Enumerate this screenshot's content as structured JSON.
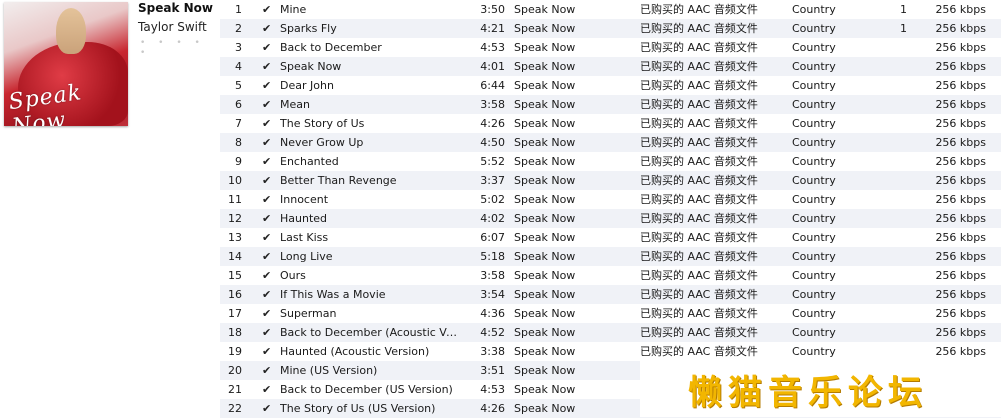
{
  "album": {
    "title": "Speak Now",
    "artist": "Taylor Swift",
    "rating": "• • • • •",
    "cover_text": "Speak Now"
  },
  "watermark": "懒猫音乐论坛",
  "tracks": [
    {
      "num": "1",
      "check": "✔",
      "name": "Mine",
      "time": "3:50",
      "album": "Speak Now",
      "kind": "已购买的 AAC 音频文件",
      "genre": "Country",
      "plays": "1",
      "bitrate": "256 kbps"
    },
    {
      "num": "2",
      "check": "✔",
      "name": "Sparks Fly",
      "time": "4:21",
      "album": "Speak Now",
      "kind": "已购买的 AAC 音频文件",
      "genre": "Country",
      "plays": "1",
      "bitrate": "256 kbps"
    },
    {
      "num": "3",
      "check": "✔",
      "name": "Back to December",
      "time": "4:53",
      "album": "Speak Now",
      "kind": "已购买的 AAC 音频文件",
      "genre": "Country",
      "plays": "",
      "bitrate": "256 kbps"
    },
    {
      "num": "4",
      "check": "✔",
      "name": "Speak Now",
      "time": "4:01",
      "album": "Speak Now",
      "kind": "已购买的 AAC 音频文件",
      "genre": "Country",
      "plays": "",
      "bitrate": "256 kbps"
    },
    {
      "num": "5",
      "check": "✔",
      "name": "Dear John",
      "time": "6:44",
      "album": "Speak Now",
      "kind": "已购买的 AAC 音频文件",
      "genre": "Country",
      "plays": "",
      "bitrate": "256 kbps"
    },
    {
      "num": "6",
      "check": "✔",
      "name": "Mean",
      "time": "3:58",
      "album": "Speak Now",
      "kind": "已购买的 AAC 音频文件",
      "genre": "Country",
      "plays": "",
      "bitrate": "256 kbps"
    },
    {
      "num": "7",
      "check": "✔",
      "name": "The Story of Us",
      "time": "4:26",
      "album": "Speak Now",
      "kind": "已购买的 AAC 音频文件",
      "genre": "Country",
      "plays": "",
      "bitrate": "256 kbps"
    },
    {
      "num": "8",
      "check": "✔",
      "name": "Never Grow Up",
      "time": "4:50",
      "album": "Speak Now",
      "kind": "已购买的 AAC 音频文件",
      "genre": "Country",
      "plays": "",
      "bitrate": "256 kbps"
    },
    {
      "num": "9",
      "check": "✔",
      "name": "Enchanted",
      "time": "5:52",
      "album": "Speak Now",
      "kind": "已购买的 AAC 音频文件",
      "genre": "Country",
      "plays": "",
      "bitrate": "256 kbps"
    },
    {
      "num": "10",
      "check": "✔",
      "name": "Better Than Revenge",
      "time": "3:37",
      "album": "Speak Now",
      "kind": "已购买的 AAC 音频文件",
      "genre": "Country",
      "plays": "",
      "bitrate": "256 kbps"
    },
    {
      "num": "11",
      "check": "✔",
      "name": "Innocent",
      "time": "5:02",
      "album": "Speak Now",
      "kind": "已购买的 AAC 音频文件",
      "genre": "Country",
      "plays": "",
      "bitrate": "256 kbps"
    },
    {
      "num": "12",
      "check": "✔",
      "name": "Haunted",
      "time": "4:02",
      "album": "Speak Now",
      "kind": "已购买的 AAC 音频文件",
      "genre": "Country",
      "plays": "",
      "bitrate": "256 kbps"
    },
    {
      "num": "13",
      "check": "✔",
      "name": "Last Kiss",
      "time": "6:07",
      "album": "Speak Now",
      "kind": "已购买的 AAC 音频文件",
      "genre": "Country",
      "plays": "",
      "bitrate": "256 kbps"
    },
    {
      "num": "14",
      "check": "✔",
      "name": "Long Live",
      "time": "5:18",
      "album": "Speak Now",
      "kind": "已购买的 AAC 音频文件",
      "genre": "Country",
      "plays": "",
      "bitrate": "256 kbps"
    },
    {
      "num": "15",
      "check": "✔",
      "name": "Ours",
      "time": "3:58",
      "album": "Speak Now",
      "kind": "已购买的 AAC 音频文件",
      "genre": "Country",
      "plays": "",
      "bitrate": "256 kbps"
    },
    {
      "num": "16",
      "check": "✔",
      "name": "If This Was a Movie",
      "time": "3:54",
      "album": "Speak Now",
      "kind": "已购买的 AAC 音频文件",
      "genre": "Country",
      "plays": "",
      "bitrate": "256 kbps"
    },
    {
      "num": "17",
      "check": "✔",
      "name": "Superman",
      "time": "4:36",
      "album": "Speak Now",
      "kind": "已购买的 AAC 音频文件",
      "genre": "Country",
      "plays": "",
      "bitrate": "256 kbps"
    },
    {
      "num": "18",
      "check": "✔",
      "name": "Back to December (Acoustic Vers...",
      "time": "4:52",
      "album": "Speak Now",
      "kind": "已购买的 AAC 音频文件",
      "genre": "Country",
      "plays": "",
      "bitrate": "256 kbps"
    },
    {
      "num": "19",
      "check": "✔",
      "name": "Haunted (Acoustic Version)",
      "time": "3:38",
      "album": "Speak Now",
      "kind": "已购买的 AAC 音频文件",
      "genre": "Country",
      "plays": "",
      "bitrate": "256 kbps"
    },
    {
      "num": "20",
      "check": "✔",
      "name": "Mine (US Version)",
      "time": "3:51",
      "album": "Speak Now",
      "kind": "已购",
      "genre": "",
      "plays": "",
      "bitrate": "256 kbps"
    },
    {
      "num": "21",
      "check": "✔",
      "name": "Back to December (US Version)",
      "time": "4:53",
      "album": "Speak Now",
      "kind": "已",
      "genre": "",
      "plays": "",
      "bitrate": "256 kbps"
    },
    {
      "num": "22",
      "check": "✔",
      "name": "The Story of Us (US Version)",
      "time": "4:26",
      "album": "Speak Now",
      "kind": "已",
      "genre": "",
      "plays": "",
      "bitrate": "256 kbps"
    }
  ]
}
